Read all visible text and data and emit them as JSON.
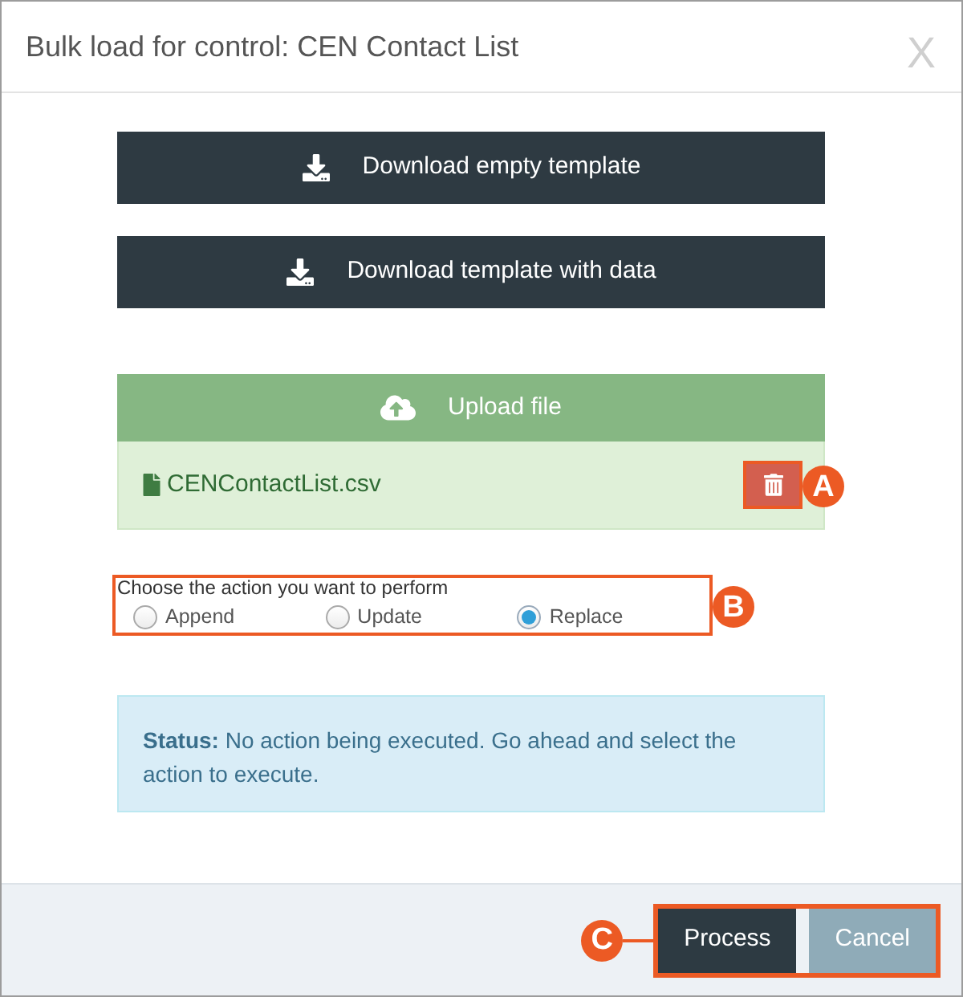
{
  "dialog": {
    "title": "Bulk load for control: CEN Contact List",
    "close_label": "X"
  },
  "downloads": [
    {
      "label": "Download empty template"
    },
    {
      "label": "Download template with data"
    }
  ],
  "upload": {
    "label": "Upload file",
    "file": {
      "name": "CENContactList.csv",
      "callout": "A"
    }
  },
  "action": {
    "prompt": "Choose the action you want to perform",
    "callout": "B",
    "options": [
      {
        "label": "Append",
        "selected": false
      },
      {
        "label": "Update",
        "selected": false
      },
      {
        "label": "Replace",
        "selected": true
      }
    ]
  },
  "status": {
    "text": "**Status:** No action being executed. Go ahead and select the action to execute."
  },
  "footer": {
    "callout": "C",
    "buttons": [
      {
        "label": "Process",
        "disabled": false
      },
      {
        "label": "Cancel",
        "disabled": true
      }
    ]
  }
}
